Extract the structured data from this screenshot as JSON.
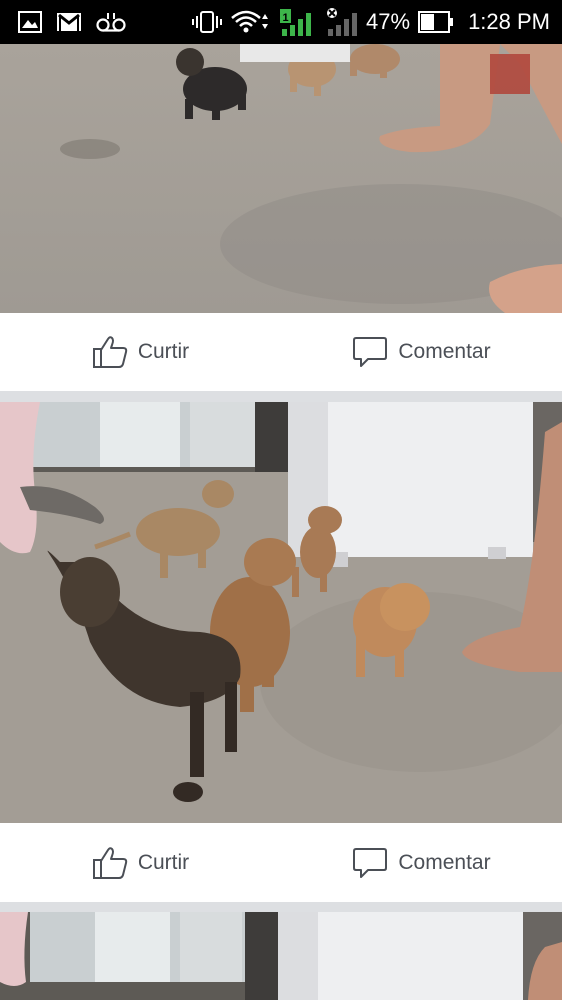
{
  "statusbar": {
    "left_icons": [
      "gallery-icon",
      "gmail-icon",
      "voicemail-icon"
    ],
    "right_icons": [
      "vibrate-icon",
      "wifi-icon",
      "signal-icon",
      "signal-noservice-icon",
      "battery-icon"
    ],
    "battery": "47%",
    "time": "1:28 PM"
  },
  "feed": {
    "posts": [
      {
        "photo_icon": "puppies-photo",
        "like_label": "Curtir",
        "comment_label": "Comentar"
      },
      {
        "photo_icon": "puppies-photo",
        "like_label": "Curtir",
        "comment_label": "Comentar"
      },
      {
        "photo_icon": "puppies-photo"
      }
    ]
  },
  "colors": {
    "statusbar_bg": "#000000",
    "action_text": "#4b4f56",
    "separator": "#dddfe2",
    "card_bg": "#ffffff",
    "signal_green": "#3db54a"
  }
}
